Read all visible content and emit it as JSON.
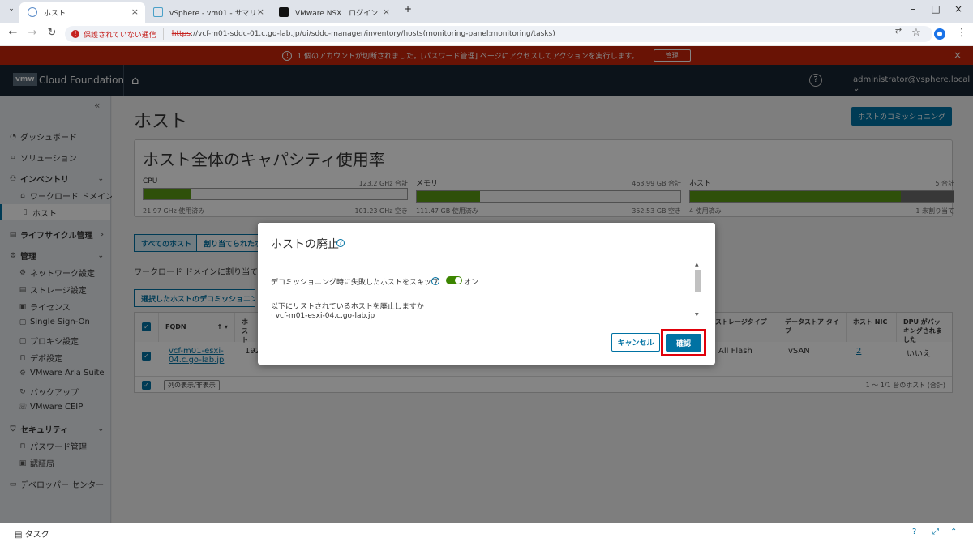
{
  "browser": {
    "tabs": [
      {
        "title": "ホスト",
        "active": true
      },
      {
        "title": "vSphere - vm01 - サマリ",
        "active": false
      },
      {
        "title": "VMware NSX | ログイン",
        "active": false
      }
    ],
    "security_label": "保護されていない通信",
    "url_scheme": "https",
    "url_rest": "://vcf-m01-sddc-01.c.go-lab.jp/ui/sddc-manager/inventory/hosts(monitoring-panel:monitoring/tasks)"
  },
  "alert": {
    "message": "1 個のアカウントが切断されました。[パスワード管理] ページにアクセスしてアクションを実行します。",
    "button": "管理"
  },
  "header": {
    "logo": "vmw",
    "product": "Cloud Foundation",
    "user": "administrator@vsphere.local"
  },
  "sidebar": {
    "collapse": "«",
    "items": [
      {
        "label": "ダッシュボード"
      },
      {
        "label": "ソリューション"
      },
      {
        "label": "インベントリ"
      },
      {
        "label": "ワークロード ドメイン"
      },
      {
        "label": "ホスト"
      },
      {
        "label": "ライフサイクル管理"
      },
      {
        "label": "管理"
      },
      {
        "label": "ネットワーク設定"
      },
      {
        "label": "ストレージ設定"
      },
      {
        "label": "ライセンス"
      },
      {
        "label": "Single Sign-On"
      },
      {
        "label": "プロキシ設定"
      },
      {
        "label": "デポ設定"
      },
      {
        "label": "VMware Aria Suite"
      },
      {
        "label": "バックアップ"
      },
      {
        "label": "VMware CEIP"
      },
      {
        "label": "セキュリティ"
      },
      {
        "label": "パスワード管理"
      },
      {
        "label": "認証局"
      },
      {
        "label": "デベロッパー センター"
      }
    ]
  },
  "main": {
    "title": "ホスト",
    "commission_button": "ホストのコミッショニング",
    "capacity": {
      "title": "ホスト全体のキャパシティ使用率",
      "cpu": {
        "label": "CPU",
        "total": "123.2 GHz 合計",
        "used": "21.97 GHz 使用済み",
        "free": "101.23 GHz 空き",
        "used_fraction": 0.178
      },
      "memory": {
        "label": "メモリ",
        "total": "463.99 GB 合計",
        "used": "111.47 GB 使用済み",
        "free": "352.53 GB 空き",
        "used_fraction": 0.24
      },
      "host": {
        "label": "ホスト",
        "total": "5 合計",
        "used": "4 使用済み",
        "free": "1 未割り当て",
        "used_fraction": 0.8
      }
    },
    "filter_tabs": [
      "すべてのホスト",
      "割り当てられたホスト"
    ],
    "workload_text": "ワークロード ドメインに割り当てられ",
    "decommission_button": "選択したホストのデコミッショニング",
    "table": {
      "headers": {
        "fqdn": "FQDN",
        "ip": "ホスト",
        "storage_type": "ストレージタイプ",
        "datastore_type": "データストア タイプ",
        "host_nic": "ホスト NIC",
        "dpu": "DPU がバッキングされました"
      },
      "row": {
        "fqdn": "vcf-m01-esxi-04.c.go-lab.jp",
        "ip": "192",
        "storage_type": "All Flash",
        "datastore_type": "vSAN",
        "host_nic": "2",
        "dpu": "いいえ"
      },
      "column_toggle": "列の表示/非表示",
      "pager": "1 ～ 1/1 台のホスト (合計)"
    }
  },
  "modal": {
    "title": "ホストの廃止",
    "skip_label": "デコミッショニング時に失敗したホストをスキップ",
    "toggle_state": "オン",
    "list_header": "以下にリストされているホストを廃止しますか",
    "host": "vcf-m01-esxi-04.c.go-lab.jp",
    "cancel": "キャンセル",
    "confirm": "確認"
  },
  "bottom": {
    "task_label": "タスク"
  }
}
